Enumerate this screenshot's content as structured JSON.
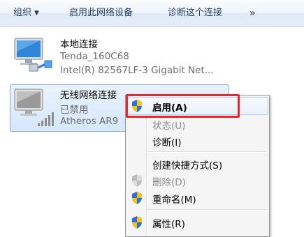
{
  "toolbar": {
    "organize": "组织",
    "enable_device": "启用此网络设备",
    "diagnose": "诊断这个连接",
    "more": "»"
  },
  "connections": [
    {
      "name": "本地连接",
      "line1": "Tenda_160C68",
      "line2": "Intel(R) 82567LF-3 Gigabit Net...",
      "icon": "wired-network-icon"
    },
    {
      "name": "无线网络连接",
      "line1": "已禁用",
      "line2": "Atheros AR9",
      "icon": "wireless-network-icon",
      "selected": true
    }
  ],
  "context_menu": {
    "items": [
      {
        "label": "启用(A)",
        "bold": true,
        "icon": "shield-icon",
        "disabled": false
      },
      {
        "label": "状态(U)",
        "disabled": true
      },
      {
        "label": "诊断(I)",
        "disabled": false
      },
      {
        "label": "创建快捷方式(S)",
        "disabled": false
      },
      {
        "label": "删除(D)",
        "disabled": true,
        "icon": "shield-icon"
      },
      {
        "label": "重命名(M)",
        "disabled": false,
        "icon": "shield-icon"
      },
      {
        "label": "属性(R)",
        "disabled": false,
        "icon": "shield-icon"
      }
    ]
  },
  "colors": {
    "highlight_border": "#e8262b",
    "selection_border": "#84acdd"
  }
}
